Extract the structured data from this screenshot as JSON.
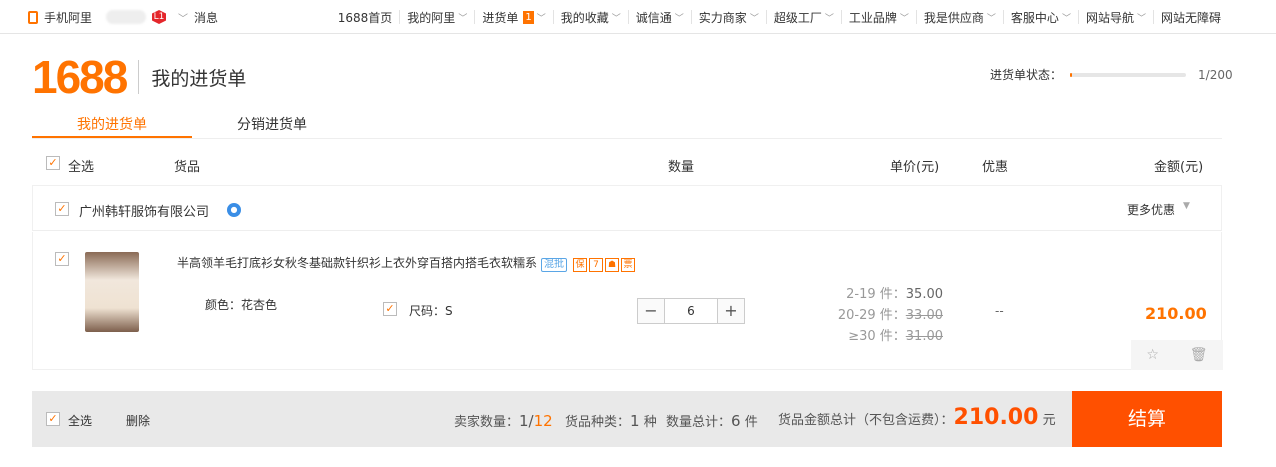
{
  "topbar": {
    "mobile_label": "手机阿里",
    "level_badge": "L1",
    "messages": "消息",
    "nav": [
      "1688首页",
      "我的阿里",
      "进货单",
      "我的收藏",
      "诚信通",
      "实力商家",
      "超级工厂",
      "工业品牌",
      "我是供应商",
      "客服中心",
      "网站导航",
      "网站无障碍"
    ],
    "cart_count": "1"
  },
  "header": {
    "logo": "1688",
    "title": "我的进货单",
    "status_label": "进货单状态：",
    "status_count": "1/200",
    "status_fill": 0.005
  },
  "tabs": [
    "我的进货单",
    "分销进货单"
  ],
  "columns": {
    "select_all": "全选",
    "goods": "货品",
    "quantity": "数量",
    "unit_price": "单价(元)",
    "discount": "优惠",
    "amount": "金额(元)"
  },
  "shop": {
    "name": "广州韩轩服饰有限公司",
    "more_discount": "更多优惠"
  },
  "item": {
    "title": "半高领羊毛打底衫女秋冬基础款针织衫上衣外穿百搭内搭毛衣软糯系",
    "tag": "混批",
    "color_label": "颜色：花杏色",
    "size_label": "尺码：S",
    "quantity": "6",
    "tiers": [
      {
        "range": "2-19 件：",
        "price": "35.00"
      },
      {
        "range": "20-29 件：",
        "price": "33.00"
      },
      {
        "range": "≥30 件：",
        "price": "31.00"
      }
    ],
    "discount": "--",
    "amount": "210.00"
  },
  "footer": {
    "select_all": "全选",
    "delete": "删除",
    "seller_label": "卖家数量：",
    "seller_val": "1/",
    "seller_total": "12",
    "kinds_label": "货品种类：",
    "kinds_val": "1",
    "kinds_unit": "种",
    "qty_label": "数量总计：",
    "qty_val": "6",
    "qty_unit": "件",
    "total_label": "货品金额总计（不包含运费）：",
    "total": "210.00",
    "currency": "元",
    "checkout": "结算"
  },
  "colors": {
    "accent": "#ff7300",
    "checkout": "#ff5000"
  }
}
